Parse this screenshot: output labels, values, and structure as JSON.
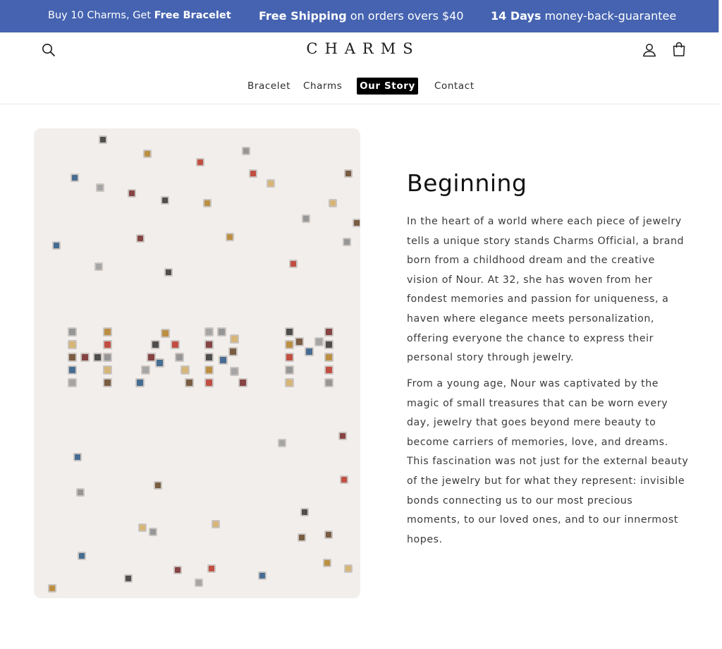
{
  "promo": {
    "item1_text": "Buy 10 Charms, Get ",
    "item1_bold": "Free Bracelet",
    "item2_bold": "Free Shipping",
    "item2_text": " on orders overs $40",
    "item3_bold": "14 Days",
    "item3_text": " money-back-guarantee"
  },
  "header": {
    "logo": "CHARMS",
    "search_icon": "search-icon",
    "account_icon": "account-icon",
    "cart_icon": "cart-icon"
  },
  "nav": {
    "items": [
      {
        "label": "Bracelet",
        "active": false
      },
      {
        "label": "Charms",
        "active": false
      },
      {
        "label": "Our Story",
        "active": true
      },
      {
        "label": "Contact",
        "active": false
      }
    ]
  },
  "story": {
    "title": "Beginning",
    "paragraphs": [
      "In the heart of a world where each piece of jewelry tells a unique story stands Charms Official, a brand born from a childhood dream and the creative vision of Nour. At 32, she has woven from her fondest memories and passion for uniqueness, a haven where elegance meets personalization, offering everyone the chance to express their personal story through jewelry.",
      "From a young age, Nour was captivated by the magic of small treasures that can be worn every day, jewelry that goes beyond mere beauty to become carriers of memories, love, and dreams. This fascination was not just for the external beauty of the jewelry but for what they represent: invisible bonds connecting us to our most precious moments, to our loved ones, and to our innermost hopes."
    ]
  },
  "colors": {
    "promo_bg": "#4563b0",
    "nav_active_bg": "#000000",
    "image_bg": "#f2eeec"
  }
}
